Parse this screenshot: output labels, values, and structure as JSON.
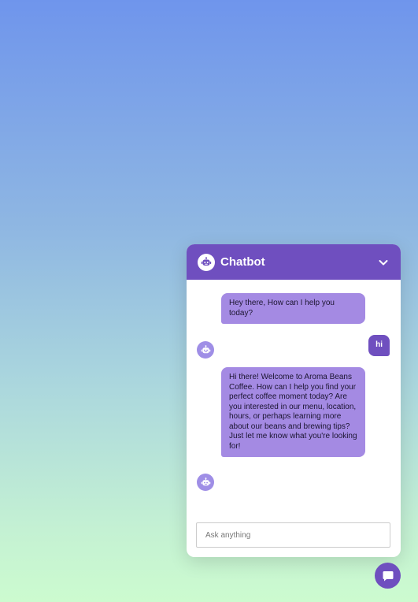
{
  "chatbot": {
    "title": "Chatbot",
    "header_icon": "robot-icon",
    "collapse_icon": "chevron-down-icon",
    "input_placeholder": "Ask anything",
    "toggle_icon": "chat-bubble-icon",
    "colors": {
      "primary": "#6f4fbf",
      "bot_bubble": "#a48ae3",
      "bot_avatar": "#9f8ee6"
    },
    "messages": [
      {
        "sender": "bot",
        "text": "Hey there, How can I help you today?"
      },
      {
        "sender": "user",
        "text": "hi"
      },
      {
        "sender": "bot",
        "text": "Hi there! Welcome to Aroma Beans Coffee. How can I help you find your perfect coffee moment today? Are you interested in our menu, location, hours, or perhaps learning more about our beans and brewing tips? Just let me know what you're looking for!"
      }
    ]
  }
}
